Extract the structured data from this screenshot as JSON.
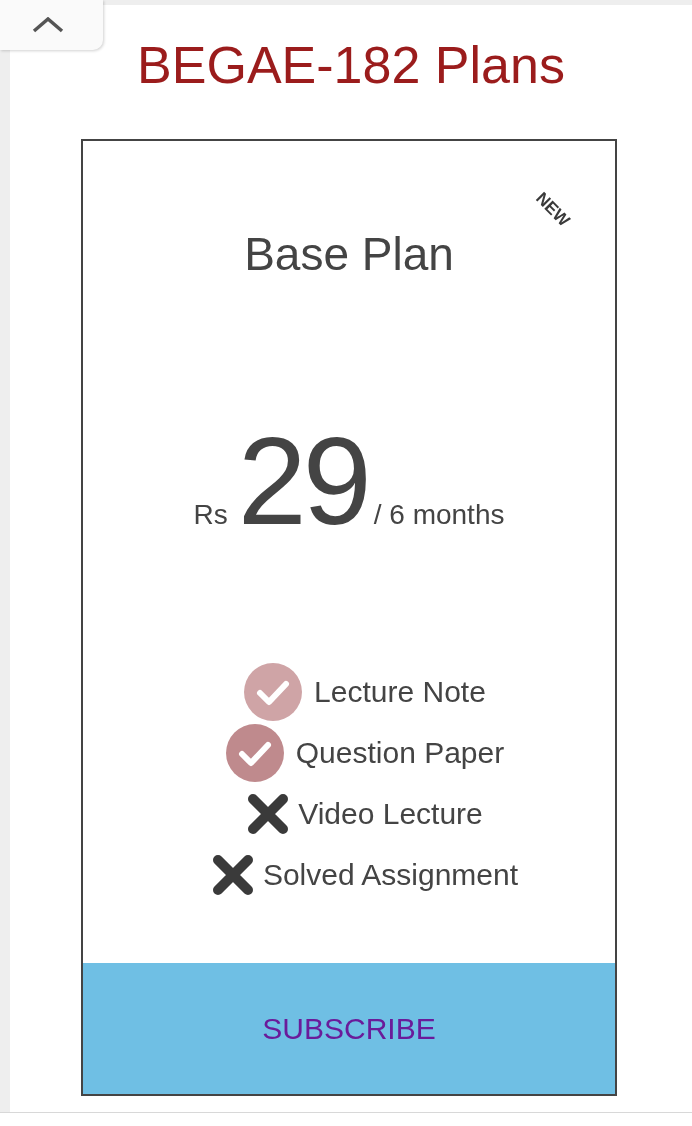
{
  "title": "BEGAE-182 Plans",
  "plan": {
    "name": "Base Plan",
    "badge": "NEW",
    "currency": "Rs",
    "price": "29",
    "period": "/ 6 months",
    "features": [
      {
        "label": "Lecture Note",
        "included": true,
        "color": "#cfa4a6"
      },
      {
        "label": "Question Paper",
        "included": true,
        "color": "#bf8a8d"
      },
      {
        "label": "Video Lecture",
        "included": false,
        "color": "#3a3a3a"
      },
      {
        "label": "Solved Assignment",
        "included": false,
        "color": "#3a3a3a"
      }
    ],
    "button": "SUBSCRIBE"
  }
}
